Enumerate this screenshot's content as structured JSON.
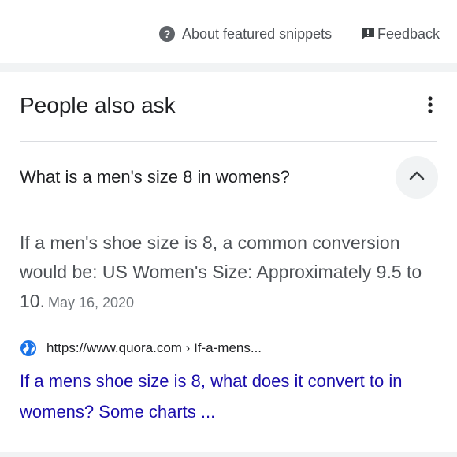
{
  "header": {
    "about_label": "About featured snippets",
    "feedback_label": "Feedback"
  },
  "paa": {
    "title": "People also ask",
    "question": "What is a men's size 8 in womens?",
    "answer": "If a men's shoe size is 8, a common conversion would be: US Women's Size: Approximately 9.5 to 10.",
    "date": "May 16, 2020",
    "source_url": "https://www.quora.com › If-a-mens...",
    "result_title": "If a mens shoe size is 8, what does it convert to in womens? Some charts ..."
  },
  "colors": {
    "link": "#1a0dab",
    "globe": "#1a73e8",
    "secondary_text": "#4d5156",
    "band": "#f1f3f4"
  },
  "icons": {
    "help": "help-circle-icon",
    "feedback": "feedback-icon",
    "more": "more-vert-icon",
    "collapse": "chevron-up-icon",
    "site": "globe-icon"
  }
}
